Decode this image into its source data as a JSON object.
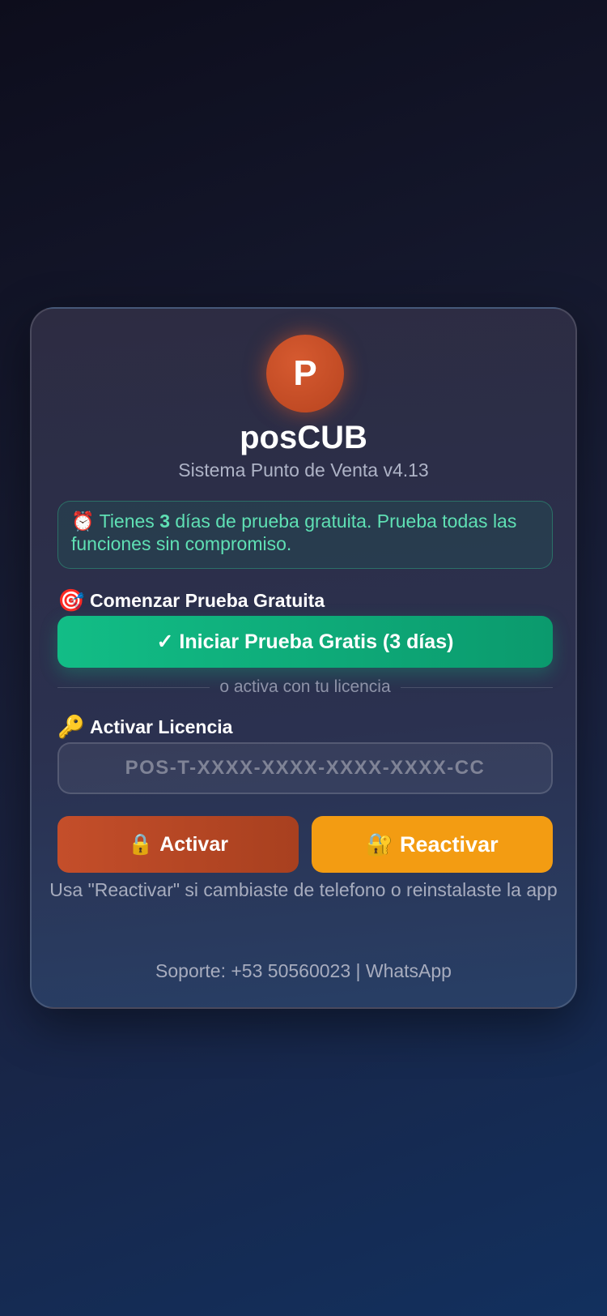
{
  "app": {
    "logo_letter": "P",
    "name": "posCUB",
    "subtitle": "Sistema Punto de Venta v4.13"
  },
  "trial_notice": {
    "icon": "alarm-clock-icon",
    "emoji": "⏰",
    "prefix": "Tienes",
    "days": "3",
    "suffix": "días de prueba gratuita. Prueba todas las funciones sin compromiso."
  },
  "trial_section": {
    "icon": "target-icon",
    "emoji": "🎯",
    "label": "Comenzar Prueba Gratuita",
    "button_label": "✓ Iniciar Prueba Gratis (3 días)"
  },
  "divider_text": "o activa con tu licencia",
  "license_section": {
    "icon": "key-icon",
    "emoji": "🔑",
    "label": "Activar Licencia",
    "input_value": "",
    "input_placeholder": "POS-T-XXXX-XXXX-XXXX-XXXX-CC"
  },
  "actions": {
    "activate_emoji": "🔒",
    "activate_icon": "lock-icon",
    "activate_label": "Activar",
    "reactivate_emoji": "🔐",
    "reactivate_icon": "lock-with-key-icon",
    "reactivate_label": "Reactivar"
  },
  "hint": "Usa \"Reactivar\" si cambiaste de telefono o reinstalaste la app",
  "support": "Soporte: +53 50560023 | WhatsApp",
  "colors": {
    "trial_green": "#10b981",
    "activate_orange": "#c44e2a",
    "reactivate_amber": "#f39c12",
    "logo_orange": "#c94a22"
  }
}
